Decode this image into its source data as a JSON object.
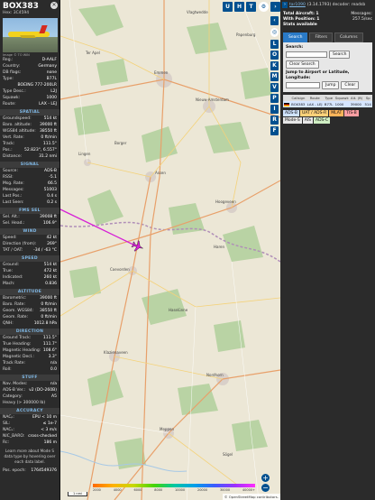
{
  "info": {
    "callsign": "BOX383",
    "hex_label": "Hex:",
    "hex": "3C4594",
    "photo_credit": "Image © TO WIN",
    "identity": [
      {
        "k": "Reg.:",
        "v": "D-AALF"
      },
      {
        "k": "Country:",
        "v": "Germany"
      },
      {
        "k": "DB flags:",
        "v": "none"
      },
      {
        "k": "Type:",
        "v": "B77L"
      },
      {
        "k": "",
        "v": "BOEING 777-200LR"
      },
      {
        "k": "Type Desc.:",
        "v": "L2J"
      },
      {
        "k": "Squawk:",
        "v": "1000"
      },
      {
        "k": "Route:",
        "v": "LAX - LEJ"
      }
    ],
    "sections": [
      {
        "title": "SPATIAL",
        "rows": [
          {
            "k": "Groundspeed:",
            "v": "514 kt"
          },
          {
            "k": "Baro. altitude:",
            "v": "39000 ft"
          },
          {
            "k": "WGS84 altitude:",
            "v": "38550 ft"
          },
          {
            "k": "Vert. Rate:",
            "v": "0 ft/min"
          },
          {
            "k": "Track:",
            "v": "111.5°"
          },
          {
            "k": "Pos.:",
            "v": "52.823°, 6.557°"
          },
          {
            "k": "Distance:",
            "v": "31.2 nmi"
          }
        ]
      },
      {
        "title": "SIGNAL",
        "rows": [
          {
            "k": "Source:",
            "v": "ADS-B"
          },
          {
            "k": "RSSI:",
            "v": "-5.1"
          },
          {
            "k": "Msg. Rate:",
            "v": "66.5"
          },
          {
            "k": "Messages:",
            "v": "51003"
          },
          {
            "k": "Last Pos.:",
            "v": "0.4 s"
          },
          {
            "k": "Last Seen:",
            "v": "0.2 s"
          }
        ]
      },
      {
        "title": "FMS SEL",
        "rows": [
          {
            "k": "Sel. Alt.:",
            "v": "39008 ft"
          },
          {
            "k": "Sel. Head.:",
            "v": "106.9°"
          }
        ]
      },
      {
        "title": "WIND",
        "rows": [
          {
            "k": "Speed:",
            "v": "42 kt"
          },
          {
            "k": "Direction (from):",
            "v": "269°"
          },
          {
            "k": "TAT / OAT:",
            "v": "-34 / -63 °C"
          }
        ]
      },
      {
        "title": "SPEED",
        "rows": [
          {
            "k": "Ground:",
            "v": "514 kt"
          },
          {
            "k": "True:",
            "v": "472 kt"
          },
          {
            "k": "Indicated:",
            "v": "260 kt"
          },
          {
            "k": "Mach:",
            "v": "0.836"
          }
        ]
      },
      {
        "title": "ALTITUDE",
        "rows": [
          {
            "k": "Barometric:",
            "v": "39000 ft"
          },
          {
            "k": "Baro. Rate:",
            "v": "0 ft/min"
          },
          {
            "k": "Geom. WGS84:",
            "v": "38550 ft"
          },
          {
            "k": "Geom. Rate:",
            "v": "0 ft/min"
          },
          {
            "k": "QNH:",
            "v": "1012.8 hPa"
          }
        ]
      },
      {
        "title": "DIRECTION",
        "rows": [
          {
            "k": "Ground Track:",
            "v": "111.5°"
          },
          {
            "k": "True Heading:",
            "v": "111.7°"
          },
          {
            "k": "Magnetic Heading:",
            "v": "108.6°"
          },
          {
            "k": "Magnetic Decl.:",
            "v": "3.3°"
          },
          {
            "k": "Track Rate:",
            "v": "n/a"
          },
          {
            "k": "Roll:",
            "v": "0.0"
          }
        ]
      },
      {
        "title": "STUFF",
        "rows": [
          {
            "k": "Nav. Modes:",
            "v": "n/a"
          },
          {
            "k": "ADS-B Ver.:",
            "v": "v2 (DO-260B)"
          },
          {
            "k": "Category:",
            "v": "A5"
          },
          {
            "k": "Heavy (> 300000 lb)",
            "v": ""
          }
        ]
      },
      {
        "title": "ACCURACY",
        "rows": [
          {
            "k": "NACₚ:",
            "v": "EPU < 10 m"
          },
          {
            "k": "SIL:",
            "v": "≤ 1e-7"
          },
          {
            "k": "NACᵥ:",
            "v": "< 3 m/s"
          },
          {
            "k": "NIC_BARO:",
            "v": "cross-checked"
          },
          {
            "k": "Rc:",
            "v": "186 m"
          }
        ]
      }
    ],
    "blurb": "Learn more about Mode S data type by hovering over each data label.",
    "footer": {
      "k": "Pos. epoch:",
      "v": "1764549376"
    }
  },
  "map": {
    "top_buttons": [
      "U",
      "H",
      "T"
    ],
    "side_buttons": [
      "L",
      "O",
      "K",
      "M",
      "V",
      "P",
      "I",
      "R",
      "F"
    ],
    "places": [
      "Emmen",
      "Assen",
      "Nieuw-Amsterdam",
      "Coevorden",
      "Hoogeveen",
      "Klazienaveen",
      "Nordhorn",
      "Meppen",
      "Lingen",
      "Haselünne",
      "Sögel",
      "Papenburg",
      "Haren",
      "Ter Apel",
      "Vlagtwedde",
      "Borger"
    ],
    "scale_label": "1 nmi",
    "alt_labels": [
      "2000",
      "4000",
      "6000",
      "8000",
      "10000",
      "20000",
      "30000",
      "40000+"
    ],
    "attribution": "© OpenStreetMap contributors.",
    "track_color": "#d61fd6",
    "plane_color": "#d61fd6"
  },
  "side": {
    "version_link": "tar1090",
    "version_text": "(3.14.1793) decoder: readsb",
    "stats": {
      "total_label": "Total Aircraft:",
      "total": "1",
      "messages_label": "Messages:",
      "messages": "257.5/sec",
      "with_pos_label": "With Position:",
      "with_pos": "1",
      "stats_label": "Stats available"
    },
    "tabs": [
      "Search",
      "Filters",
      "Columns"
    ],
    "search": {
      "label": "Search:",
      "button": "Search",
      "clear_btn": "Clear Search",
      "jump_label": "Jump to Airport or Latitude, Longitude:",
      "jump_btn": "Jump",
      "clear2": "Clear"
    },
    "table_headers": [
      "",
      "Callsign",
      "Route",
      "Type",
      "Squawk",
      "Alt. (ft)",
      "Sp"
    ],
    "table_rows": [
      [
        "",
        "BOX383",
        "LAX - LEJ",
        "B77L",
        "1000",
        "39000",
        "514"
      ]
    ],
    "sources": [
      {
        "label": "ADS-B",
        "color": "#cfe3ff"
      },
      {
        "label": "UAT / ADS-R",
        "color": "#ffd27a"
      },
      {
        "label": "MLAT",
        "color": "#ffb55a"
      },
      {
        "label": "TIS-B",
        "color": "#ff9fa3"
      },
      {
        "label": "Mode-S",
        "color": "#e7e7e7"
      },
      {
        "label": "AIS",
        "color": "#e7e7e7"
      },
      {
        "label": "ADS-C",
        "color": "#cfeec3"
      }
    ]
  }
}
